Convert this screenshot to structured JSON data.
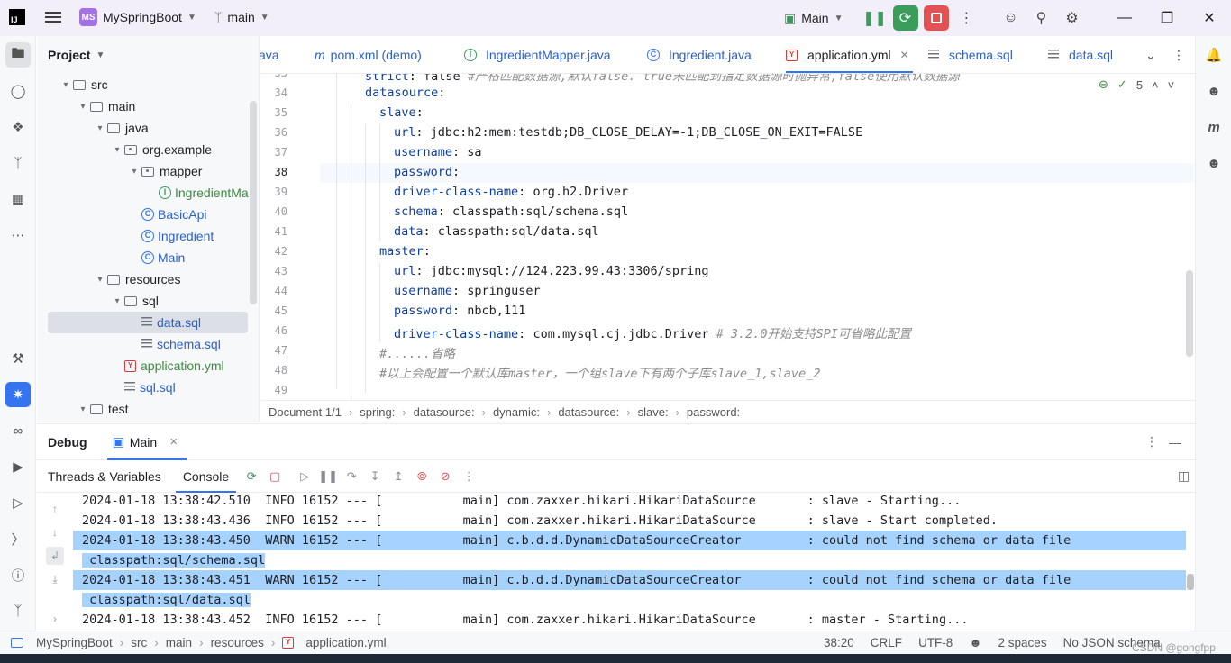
{
  "titlebar": {
    "logo": "IJ",
    "project_badge": "MS",
    "project_name": "MySpringBoot",
    "branch": "main",
    "run_config": "Main"
  },
  "project_panel": {
    "title": "Project",
    "tree": [
      {
        "label": "src",
        "type": "folder",
        "depth": 0
      },
      {
        "label": "main",
        "type": "folder",
        "depth": 1
      },
      {
        "label": "java",
        "type": "folder",
        "depth": 2
      },
      {
        "label": "org.example",
        "type": "package",
        "depth": 3
      },
      {
        "label": "mapper",
        "type": "package",
        "depth": 4
      },
      {
        "label": "IngredientMa",
        "type": "interface",
        "depth": 5
      },
      {
        "label": "BasicApi",
        "type": "class",
        "depth": 4
      },
      {
        "label": "Ingredient",
        "type": "class",
        "depth": 4
      },
      {
        "label": "Main",
        "type": "class",
        "depth": 4
      },
      {
        "label": "resources",
        "type": "folder",
        "depth": 2
      },
      {
        "label": "sql",
        "type": "folder",
        "depth": 3
      },
      {
        "label": "data.sql",
        "type": "sql",
        "depth": 4,
        "selected": true
      },
      {
        "label": "schema.sql",
        "type": "sql",
        "depth": 4
      },
      {
        "label": "application.yml",
        "type": "yml",
        "depth": 3
      },
      {
        "label": "sql.sql",
        "type": "sql",
        "depth": 3
      },
      {
        "label": "test",
        "type": "folder",
        "depth": 1
      }
    ]
  },
  "tabs": [
    {
      "label": "ava",
      "icon": "java-file-icon"
    },
    {
      "label": "pom.xml (demo)",
      "icon": "maven-icon"
    },
    {
      "label": "IngredientMapper.java",
      "icon": "interface-icon"
    },
    {
      "label": "Ingredient.java",
      "icon": "class-icon"
    },
    {
      "label": "application.yml",
      "icon": "yml-icon",
      "active": true
    },
    {
      "label": "schema.sql",
      "icon": "sql-icon"
    },
    {
      "label": "data.sql",
      "icon": "sql-icon"
    }
  ],
  "editor": {
    "inspection_count": "5",
    "lines": [
      {
        "n": "33",
        "indent": 3,
        "key": "strict",
        "val": " false ",
        "cmt": "#严格匹配数据源,默认false. true未匹配到指定数据源时抛异常,false使用默认数据源"
      },
      {
        "n": "34",
        "indent": 3,
        "key": "datasource",
        "val": "",
        "cmt": ""
      },
      {
        "n": "35",
        "indent": 4,
        "key": "slave",
        "val": "",
        "cmt": ""
      },
      {
        "n": "36",
        "indent": 5,
        "key": "url",
        "val": " jdbc:h2:mem:testdb;DB_CLOSE_DELAY=-1;DB_CLOSE_ON_EXIT=FALSE",
        "cmt": ""
      },
      {
        "n": "37",
        "indent": 5,
        "key": "username",
        "val": " sa",
        "cmt": ""
      },
      {
        "n": "38",
        "indent": 5,
        "key": "password",
        "val": "",
        "cmt": ""
      },
      {
        "n": "39",
        "indent": 5,
        "key": "driver-class-name",
        "val": " org.h2.Driver",
        "cmt": ""
      },
      {
        "n": "40",
        "indent": 5,
        "key": "schema",
        "val": " classpath:sql/schema.sql",
        "cmt": ""
      },
      {
        "n": "41",
        "indent": 5,
        "key": "data",
        "val": " classpath:sql/data.sql",
        "cmt": ""
      },
      {
        "n": "42",
        "indent": 4,
        "key": "master",
        "val": "",
        "cmt": ""
      },
      {
        "n": "43",
        "indent": 5,
        "key": "url",
        "val": " jdbc:mysql://124.223.99.43:3306/spring",
        "cmt": ""
      },
      {
        "n": "44",
        "indent": 5,
        "key": "username",
        "val": " springuser",
        "cmt": ""
      },
      {
        "n": "45",
        "indent": 5,
        "key": "password",
        "val": " nbcb,111",
        "cmt": ""
      },
      {
        "n": "46",
        "indent": 5,
        "key": "driver-class-name",
        "val": " com.mysql.cj.jdbc.Driver ",
        "cmt": "# 3.2.0开始支持SPI可省略此配置"
      },
      {
        "n": "47",
        "indent": 4,
        "key": "",
        "val": "",
        "cmt": "#......省略"
      },
      {
        "n": "48",
        "indent": 4,
        "key": "",
        "val": "",
        "cmt": "#以上会配置一个默认库master，一个组slave下有两个子库slave_1,slave_2"
      },
      {
        "n": "49",
        "indent": 0,
        "key": "",
        "val": "",
        "cmt": ""
      }
    ]
  },
  "editor_breadcrumb": [
    "Document 1/1",
    "spring:",
    "datasource:",
    "dynamic:",
    "datasource:",
    "slave:",
    "password:"
  ],
  "debug": {
    "title": "Debug",
    "session_tab": "Main",
    "subtabs": [
      "Threads & Variables",
      "Console"
    ],
    "console_lines": [
      {
        "text": "2024-01-18 13:38:42.510  INFO 16152 --- [           main] com.zaxxer.hikari.HikariDataSource       : slave - Starting...",
        "hl": false
      },
      {
        "text": "2024-01-18 13:38:43.436  INFO 16152 --- [           main] com.zaxxer.hikari.HikariDataSource       : slave - Start completed.",
        "hl": false
      },
      {
        "text": "2024-01-18 13:38:43.450  WARN 16152 --- [           main] c.b.d.d.DynamicDataSourceCreator         : could not find schema or data file",
        "hl": true
      },
      {
        "text": " classpath:sql/schema.sql",
        "hl": true
      },
      {
        "text": "2024-01-18 13:38:43.451  WARN 16152 --- [           main] c.b.d.d.DynamicDataSourceCreator         : could not find schema or data file",
        "hl": true
      },
      {
        "text": " classpath:sql/data.sql",
        "hl": true
      },
      {
        "text": "2024-01-18 13:38:43.452  INFO 16152 --- [           main] com.zaxxer.hikari.HikariDataSource       : master - Starting...",
        "hl": false
      }
    ]
  },
  "statusbar": {
    "crumbs": [
      "MySpringBoot",
      "src",
      "main",
      "resources",
      "application.yml"
    ],
    "position": "38:20",
    "line_sep": "CRLF",
    "encoding": "UTF-8",
    "indent": "2 spaces",
    "schema": "No JSON schema",
    "watermark": "CSDN @gongfpp"
  },
  "colors": {
    "accent": "#3574f0",
    "highlight": "#a6d2ff",
    "key": "#0b3ea3"
  }
}
